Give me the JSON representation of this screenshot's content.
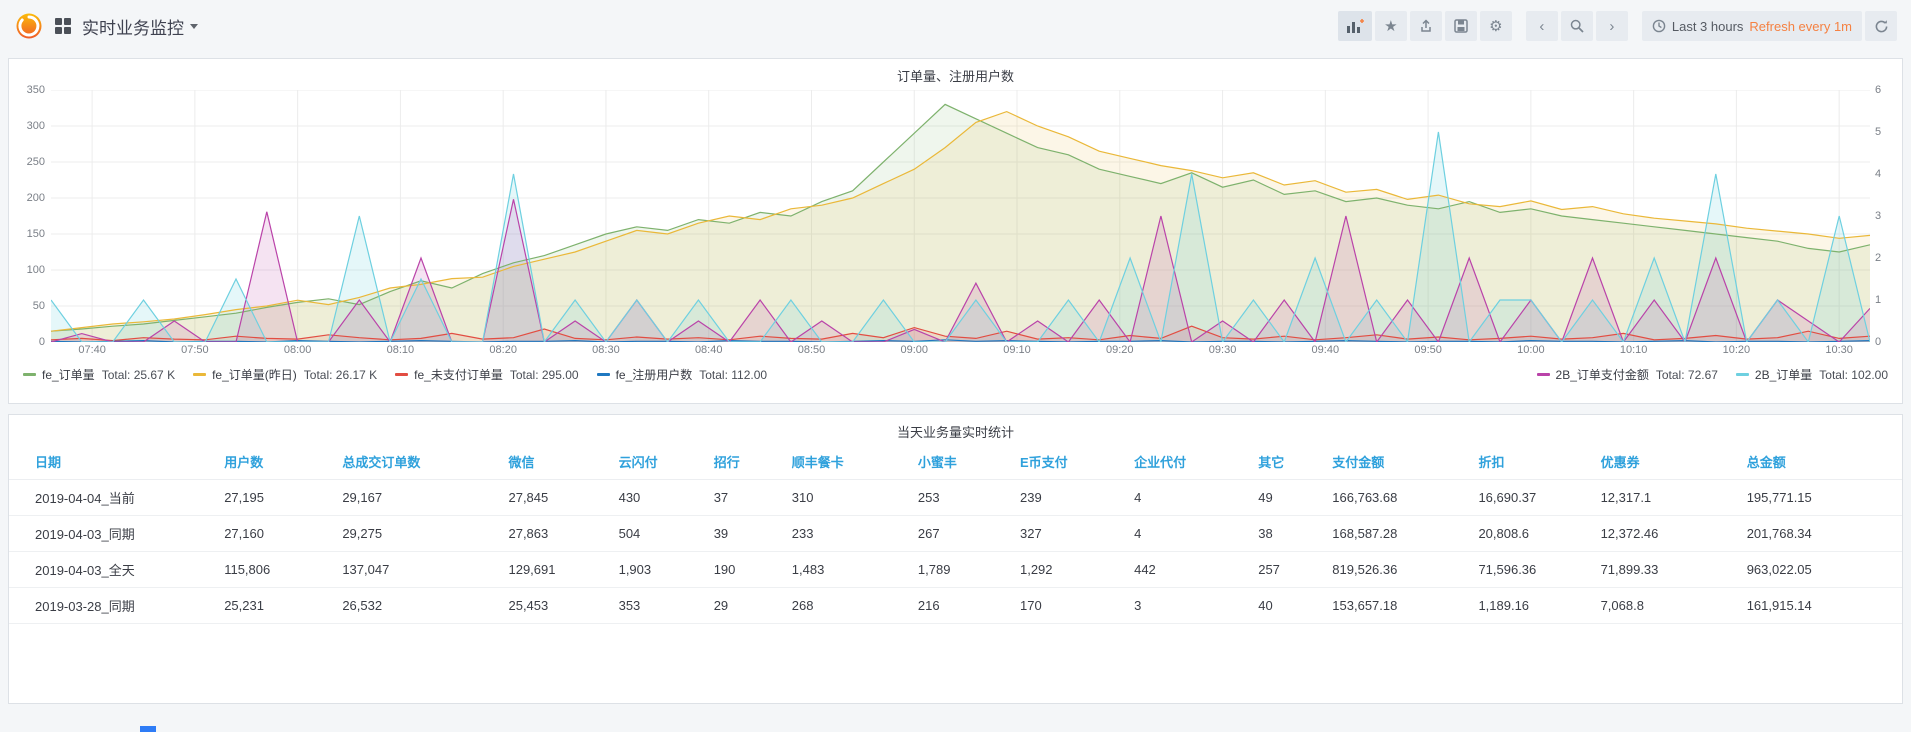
{
  "navbar": {
    "title": "实时业务监控",
    "time_range": "Last 3 hours",
    "refresh_interval": "Refresh every 1m"
  },
  "colors": {
    "accent_orange": "#f58142",
    "header_blue": "#2fa1dc",
    "logo_orange": "#f2701d"
  },
  "chart_data": {
    "type": "line",
    "title": "订单量、注册用户数",
    "t_max": 177,
    "sample_step_min": 3,
    "y_left": {
      "min": 0,
      "max": 350,
      "ticks": [
        0,
        50,
        100,
        150,
        200,
        250,
        300,
        350
      ]
    },
    "y_right": {
      "min": 0,
      "max": 6,
      "ticks": [
        0,
        1,
        2,
        3,
        4,
        5,
        6
      ]
    },
    "x_tick_t": [
      4,
      14,
      24,
      34,
      44,
      54,
      64,
      74,
      84,
      94,
      104,
      114,
      124,
      134,
      144,
      154,
      164,
      174
    ],
    "x_tick_labels": [
      "07:40",
      "07:50",
      "08:00",
      "08:10",
      "08:20",
      "08:30",
      "08:40",
      "08:50",
      "09:00",
      "09:10",
      "09:20",
      "09:30",
      "09:40",
      "09:50",
      "10:00",
      "10:10",
      "10:20",
      "10:30"
    ],
    "series": [
      {
        "name": "fe_订单量",
        "axis": "left",
        "legend": "left",
        "color": "#7EB26D",
        "fill": 0.12,
        "total_label": "Total: 25.67 K",
        "values": [
          15,
          18,
          22,
          25,
          30,
          35,
          40,
          48,
          55,
          60,
          52,
          70,
          85,
          75,
          95,
          110,
          120,
          135,
          150,
          160,
          155,
          170,
          165,
          180,
          175,
          195,
          210,
          250,
          290,
          330,
          310,
          290,
          270,
          260,
          240,
          230,
          220,
          235,
          215,
          225,
          205,
          210,
          195,
          200,
          190,
          185,
          195,
          180,
          185,
          175,
          170,
          165,
          160,
          155,
          150,
          145,
          140,
          130,
          125,
          135
        ]
      },
      {
        "name": "fe_订单量(昨日)",
        "axis": "left",
        "legend": "left",
        "color": "#EAB839",
        "fill": 0.12,
        "total_label": "Total: 26.17 K",
        "values": [
          15,
          20,
          25,
          28,
          32,
          38,
          45,
          50,
          58,
          52,
          62,
          75,
          80,
          88,
          90,
          105,
          115,
          125,
          140,
          155,
          150,
          165,
          175,
          170,
          185,
          190,
          200,
          220,
          240,
          270,
          305,
          320,
          300,
          285,
          265,
          255,
          245,
          238,
          228,
          235,
          218,
          224,
          208,
          212,
          198,
          204,
          192,
          188,
          196,
          184,
          188,
          178,
          172,
          168,
          164,
          158,
          154,
          150,
          144,
          148
        ]
      },
      {
        "name": "fe_未支付订单量",
        "axis": "left",
        "legend": "left",
        "color": "#E24D42",
        "fill": 0.12,
        "total_label": "Total: 295.00",
        "values": [
          3,
          5,
          2,
          6,
          4,
          3,
          8,
          5,
          4,
          10,
          6,
          3,
          5,
          12,
          4,
          6,
          18,
          5,
          3,
          7,
          4,
          6,
          3,
          8,
          5,
          4,
          12,
          6,
          20,
          8,
          5,
          15,
          4,
          6,
          3,
          9,
          5,
          22,
          6,
          4,
          8,
          3,
          6,
          10,
          4,
          7,
          3,
          5,
          8,
          4,
          6,
          12,
          3,
          5,
          9,
          4,
          6,
          15,
          5,
          8
        ]
      },
      {
        "name": "fe_注册用户数",
        "axis": "left",
        "legend": "left",
        "color": "#1F78C1",
        "fill": 0,
        "total_label": "Total: 112.00",
        "values": [
          1,
          0,
          1,
          2,
          0,
          1,
          1,
          0,
          2,
          1,
          0,
          1,
          2,
          1,
          0,
          1,
          1,
          2,
          0,
          1,
          1,
          0,
          2,
          1,
          1,
          0,
          1,
          2,
          1,
          3,
          1,
          2,
          1,
          0,
          1,
          1,
          2,
          0,
          1,
          1,
          0,
          1,
          2,
          1,
          0,
          1,
          1,
          0,
          2,
          1,
          1,
          0,
          1,
          2,
          0,
          1,
          1,
          0,
          1,
          2
        ]
      },
      {
        "name": "2B_订单支付金额",
        "axis": "right",
        "legend": "right",
        "color": "#BA43A9",
        "fill": 0.15,
        "total_label": "Total: 72.67",
        "values": [
          0,
          0.2,
          0,
          0,
          0.5,
          0,
          0,
          3.1,
          0,
          0,
          1,
          0,
          2,
          0,
          0,
          3.4,
          0,
          0.5,
          0,
          1,
          0,
          0.5,
          0,
          1,
          0,
          0.5,
          0,
          0,
          0.3,
          0,
          1.4,
          0,
          0.5,
          0,
          1,
          0,
          3,
          0,
          0.5,
          0,
          1,
          0,
          3,
          0,
          1,
          0,
          2,
          0,
          1,
          0,
          2,
          0,
          1,
          0,
          2,
          0,
          1,
          0.5,
          0,
          0.8
        ]
      },
      {
        "name": "2B_订单量",
        "axis": "right",
        "legend": "right",
        "color": "#6ED0E0",
        "fill": 0.18,
        "total_label": "Total: 102.00",
        "values": [
          1,
          0,
          0,
          1,
          0,
          0,
          1.5,
          0,
          0,
          0,
          3,
          0,
          1.5,
          0,
          0,
          4,
          0,
          1,
          0,
          1,
          0,
          1,
          0,
          0,
          1,
          0,
          0,
          1,
          0,
          0,
          1,
          0,
          0,
          1,
          0,
          2,
          0,
          4,
          0,
          1,
          0,
          2,
          0,
          1,
          0,
          5,
          0,
          1,
          1,
          0,
          1,
          0,
          2,
          0,
          4,
          0,
          1,
          0,
          3,
          0
        ]
      }
    ]
  },
  "table": {
    "title": "当天业务量实时统计",
    "columns": [
      "日期",
      "用户数",
      "总成交订单数",
      "微信",
      "云闪付",
      "招行",
      "顺丰餐卡",
      "小蜜丰",
      "E币支付",
      "企业代付",
      "其它",
      "支付金额",
      "折扣",
      "优惠券",
      "总金额"
    ],
    "rows": [
      [
        "2019-04-04_当前",
        "27,195",
        "29,167",
        "27,845",
        "430",
        "37",
        "310",
        "253",
        "239",
        "4",
        "49",
        "166,763.68",
        "16,690.37",
        "12,317.1",
        "195,771.15"
      ],
      [
        "2019-04-03_同期",
        "27,160",
        "29,275",
        "27,863",
        "504",
        "39",
        "233",
        "267",
        "327",
        "4",
        "38",
        "168,587.28",
        "20,808.6",
        "12,372.46",
        "201,768.34"
      ],
      [
        "2019-04-03_全天",
        "115,806",
        "137,047",
        "129,691",
        "1,903",
        "190",
        "1,483",
        "1,789",
        "1,292",
        "442",
        "257",
        "819,526.36",
        "71,596.36",
        "71,899.33",
        "963,022.05"
      ],
      [
        "2019-03-28_同期",
        "25,231",
        "26,532",
        "25,453",
        "353",
        "29",
        "268",
        "216",
        "170",
        "3",
        "40",
        "153,657.18",
        "1,189.16",
        "7,068.8",
        "161,915.14"
      ]
    ]
  }
}
